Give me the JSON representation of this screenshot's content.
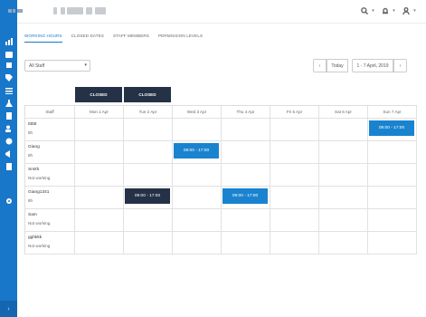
{
  "sidebar": {
    "icons": [
      "chart-icon",
      "calendar-icon",
      "box-icon",
      "tags-icon",
      "list-icon",
      "flask-icon",
      "clipboard-icon",
      "users-icon",
      "gear-icon",
      "megaphone-icon",
      "document-icon",
      "settings-icon"
    ],
    "footer_glyph": "›"
  },
  "topbar": {
    "icons": [
      "search-icon",
      "bell-icon",
      "user-icon"
    ]
  },
  "tabs": [
    {
      "label": "WORKING HOURS",
      "active": true
    },
    {
      "label": "CLOSED DATES",
      "active": false
    },
    {
      "label": "STAFF MEMBERS",
      "active": false
    },
    {
      "label": "PERMISSION LEVELS",
      "active": false
    }
  ],
  "filter": {
    "staff_select": "All Staff"
  },
  "date_nav": {
    "prev": "‹",
    "today": "Today",
    "range": "1 - 7 April, 2019",
    "next": "›"
  },
  "closed_label": "CLOSED",
  "grid": {
    "headers": [
      "Staff",
      "Mon 1 Apr",
      "Tue 2 Apr",
      "Wed 3 Apr",
      "Thu 4 Apr",
      "Fri 5 Apr",
      "Sat 6 Apr",
      "Sun 7 Apr"
    ],
    "rows": [
      {
        "name": "ttttttt",
        "sub": "8h",
        "shifts": [
          null,
          null,
          null,
          null,
          null,
          null,
          "09:00 - 17:00"
        ]
      },
      {
        "name": "Giang",
        "sub": "8h",
        "shifts": [
          null,
          null,
          "09:00 - 17:00",
          null,
          null,
          null,
          null
        ]
      },
      {
        "name": "Smith",
        "sub": "Not working",
        "shifts": [
          null,
          null,
          null,
          null,
          null,
          null,
          null
        ]
      },
      {
        "name": "Giang1341",
        "sub": "8h",
        "shifts": [
          null,
          "09:00 - 17:00",
          null,
          "09:00 - 17:00",
          null,
          null,
          null
        ]
      },
      {
        "name": "Sam",
        "sub": "Not working",
        "shifts": [
          null,
          null,
          null,
          null,
          null,
          null,
          null
        ]
      },
      {
        "name": "gghkkk",
        "sub": "Not working",
        "shifts": [
          null,
          null,
          null,
          null,
          null,
          null,
          null
        ]
      }
    ]
  },
  "colors": {
    "accent": "#1877c9",
    "shift_blue": "#1a83cf",
    "shift_dark": "#243147"
  }
}
